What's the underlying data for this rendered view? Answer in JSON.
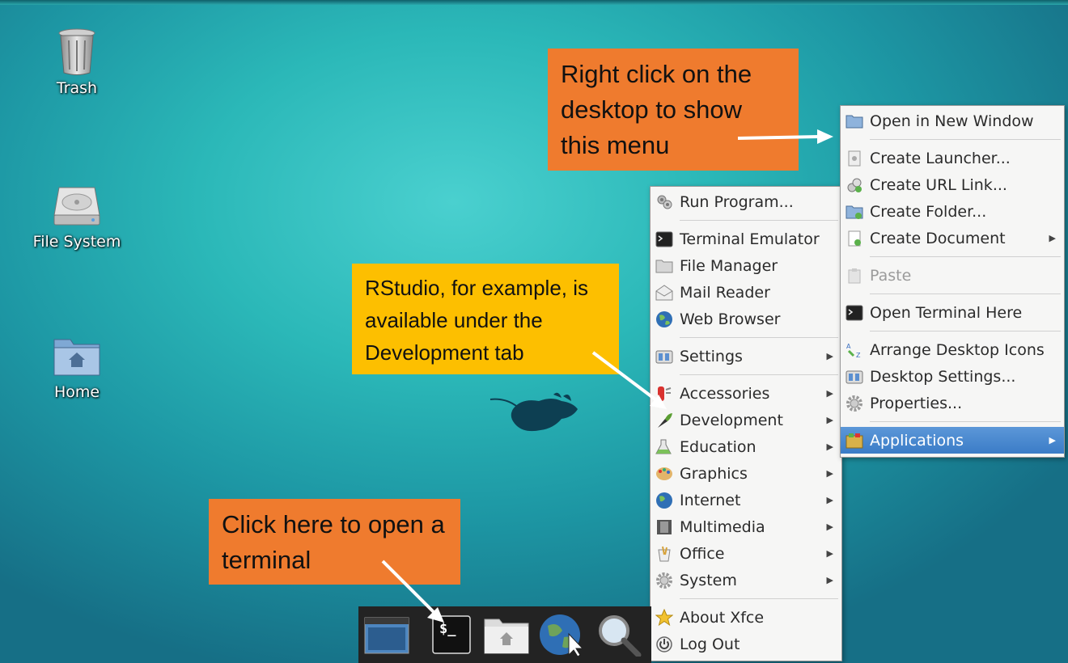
{
  "desktop": {
    "icons": [
      {
        "label": "Trash",
        "icon": "trash-icon"
      },
      {
        "label": "File System",
        "icon": "hard-drive-icon"
      },
      {
        "label": "Home",
        "icon": "home-folder-icon"
      }
    ]
  },
  "annotations": {
    "desktop_menu": "Right click on the desktop to show this menu",
    "rstudio": "RStudio, for example, is available under the Development tab",
    "terminal": "Click here to open a terminal",
    "colors": {
      "orange": "#ef7b2e",
      "yellow": "#fdbf00"
    }
  },
  "desktop_menu": {
    "items": [
      {
        "label": "Open in New Window",
        "icon": "folder-icon"
      },
      {
        "label": "Create Launcher...",
        "icon": "launcher-icon"
      },
      {
        "label": "Create URL Link...",
        "icon": "link-icon"
      },
      {
        "label": "Create Folder...",
        "icon": "new-folder-icon"
      },
      {
        "label": "Create Document",
        "icon": "new-document-icon"
      },
      {
        "label": "Paste",
        "icon": "paste-icon"
      },
      {
        "label": "Open Terminal Here",
        "icon": "terminal-icon"
      },
      {
        "label": "Arrange Desktop Icons",
        "icon": "arrange-icon"
      },
      {
        "label": "Desktop Settings...",
        "icon": "desktop-settings-icon"
      },
      {
        "label": "Properties...",
        "icon": "properties-icon"
      },
      {
        "label": "Applications",
        "icon": "applications-icon"
      }
    ]
  },
  "apps_menu": {
    "items": [
      {
        "label": "Run Program...",
        "icon": "run-program-icon"
      },
      {
        "label": "Terminal Emulator",
        "icon": "terminal-icon"
      },
      {
        "label": "File Manager",
        "icon": "folder-icon"
      },
      {
        "label": "Mail Reader",
        "icon": "mail-icon"
      },
      {
        "label": "Web Browser",
        "icon": "globe-icon"
      },
      {
        "label": "Settings",
        "icon": "settings-icon"
      },
      {
        "label": "Accessories",
        "icon": "accessories-icon"
      },
      {
        "label": "Development",
        "icon": "development-icon"
      },
      {
        "label": "Education",
        "icon": "education-icon"
      },
      {
        "label": "Graphics",
        "icon": "graphics-icon"
      },
      {
        "label": "Internet",
        "icon": "internet-icon"
      },
      {
        "label": "Multimedia",
        "icon": "multimedia-icon"
      },
      {
        "label": "Office",
        "icon": "office-icon"
      },
      {
        "label": "System",
        "icon": "system-gear-icon"
      },
      {
        "label": "About Xfce",
        "icon": "star-icon"
      },
      {
        "label": "Log Out",
        "icon": "power-icon"
      }
    ]
  },
  "taskbar": {
    "terminal_glyph": "$_",
    "items": [
      "show-desktop-icon",
      "terminal-icon",
      "home-folder-icon",
      "web-browser-icon",
      "search-icon"
    ]
  }
}
